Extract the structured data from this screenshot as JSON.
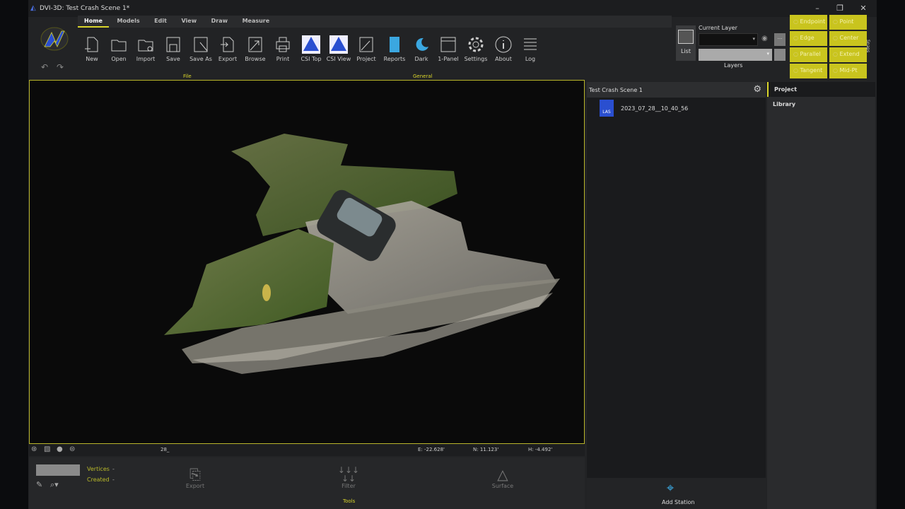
{
  "window": {
    "title": "DVI-3D: Test Crash Scene 1*",
    "minimize": "–",
    "maximize": "❐",
    "close": "✕"
  },
  "tabs": [
    "Home",
    "Models",
    "Edit",
    "View",
    "Draw",
    "Measure"
  ],
  "ribbon": {
    "buttons": [
      "New",
      "Open",
      "Import",
      "Save",
      "Save As",
      "Export",
      "Browse",
      "Print",
      "CSI Top",
      "CSI View",
      "Project",
      "Reports",
      "Dark",
      "1-Panel",
      "Settings",
      "About",
      "Log"
    ],
    "groups": {
      "file": "File",
      "general": "General"
    }
  },
  "layers": {
    "list": "List",
    "current_layer": "Current Layer",
    "layers": "Layers",
    "more": "···"
  },
  "snaps": {
    "items": [
      "Endpoint",
      "Point",
      "Edge",
      "Center",
      "Parallel",
      "Extend",
      "Tangent",
      "Mid-Pt"
    ],
    "label": "Snaps"
  },
  "status": {
    "value": "28_",
    "e": "E: -22.628'",
    "n": "N: 11.123'",
    "h": "H: -4.492'"
  },
  "bottom": {
    "vertices": "Vertices",
    "vertices_val": "-",
    "created": "Created",
    "created_val": "-",
    "export": "Export",
    "filter": "Filter",
    "surface": "Surface",
    "group": "Tools",
    "add_station": "Add Station"
  },
  "scene_panel": {
    "title": "Test Crash Scene 1",
    "file": "2023_07_28__10_40_56",
    "file_badge": "LAS"
  },
  "side_tabs": [
    "Project",
    "Library"
  ],
  "colors": {
    "accent": "#d9d52b",
    "snap": "#c9c41e"
  }
}
